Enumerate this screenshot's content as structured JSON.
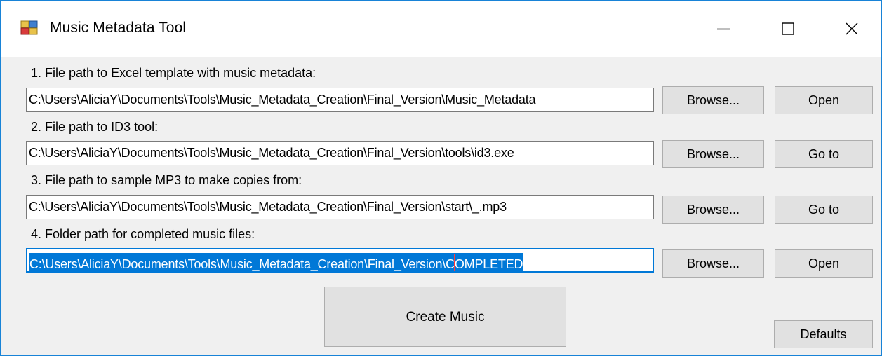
{
  "window": {
    "title": "Music Metadata Tool",
    "icon": "app-grid-icon",
    "controls": [
      "minimize-icon",
      "maximize-icon",
      "close-icon"
    ]
  },
  "fields": [
    {
      "label": "1. File path to Excel template with music metadata:",
      "value": "C:\\Users\\AliciaY\\Documents\\Tools\\Music_Metadata_Creation\\Final_Version\\Music_Metadata",
      "browse_label": "Browse...",
      "action_label": "Open"
    },
    {
      "label": "2. File path to ID3 tool:",
      "value": "C:\\Users\\AliciaY\\Documents\\Tools\\Music_Metadata_Creation\\Final_Version\\tools\\id3.exe",
      "browse_label": "Browse...",
      "action_label": "Go to"
    },
    {
      "label": "3. File path to sample MP3 to make copies from:",
      "value": "C:\\Users\\AliciaY\\Documents\\Tools\\Music_Metadata_Creation\\Final_Version\\start\\_.mp3",
      "browse_label": "Browse...",
      "action_label": "Go to"
    },
    {
      "label": "4. Folder path for completed music files:",
      "value_before_caret": "C:\\Users\\AliciaY\\Documents\\Tools\\Music_Metadata_Creation\\Final_Version\\C",
      "value_after_caret": "OMPLETED",
      "browse_label": "Browse...",
      "action_label": "Open"
    }
  ],
  "actions": {
    "create_label": "Create Music",
    "defaults_label": "Defaults"
  },
  "colors": {
    "window_border": "#1883d7",
    "client_background": "#f0f0f0",
    "button_face": "#e1e1e1",
    "selection": "#0078d7",
    "caret": "#ff3c3c"
  }
}
